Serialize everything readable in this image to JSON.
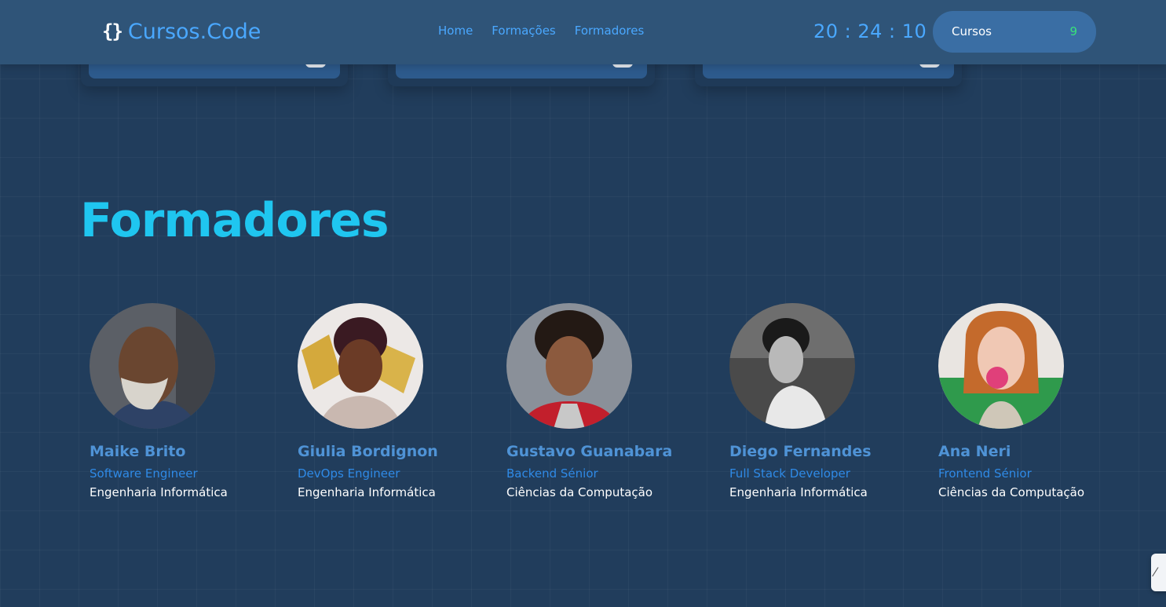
{
  "header": {
    "logo_icon": "{}",
    "logo_text": "Cursos.Code",
    "nav": [
      "Home",
      "Formações",
      "Formadores"
    ],
    "clock": "20 : 24 : 10",
    "courses_label": "Cursos",
    "courses_count": "9"
  },
  "section": {
    "title": "Formadores"
  },
  "trainers": [
    {
      "name": "Maike Brito",
      "role": "Software Engineer",
      "degree": "Engenharia Informática"
    },
    {
      "name": "Giulia Bordignon",
      "role": "DevOps Engineer",
      "degree": "Engenharia Informática"
    },
    {
      "name": "Gustavo Guanabara",
      "role": "Backend Sénior",
      "degree": "Ciências da Computação"
    },
    {
      "name": "Diego Fernandes",
      "role": "Full Stack Developer",
      "degree": "Engenharia Informática"
    },
    {
      "name": "Ana Neri",
      "role": "Frontend Sénior",
      "degree": "Ciências da Computação"
    }
  ],
  "side_widget": {
    "icon": "translate-icon"
  },
  "colors": {
    "background": "#213d5c",
    "header": "#2f5478",
    "accent": "#4aa8ff",
    "title": "#1fc6f0",
    "count": "#39e27a"
  }
}
